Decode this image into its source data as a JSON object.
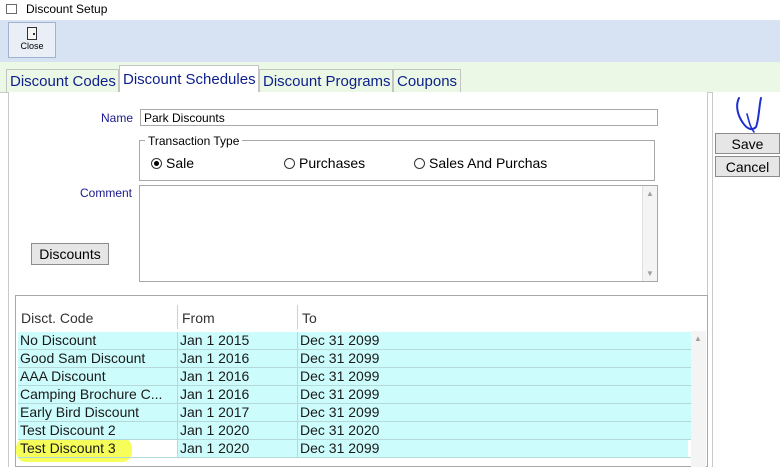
{
  "window": {
    "title": "Discount Setup"
  },
  "toolbar": {
    "close_label": "Close"
  },
  "tabs": [
    {
      "label": "Discount Codes",
      "active": false
    },
    {
      "label": "Discount Schedules",
      "active": true
    },
    {
      "label": "Discount Programs",
      "active": false
    },
    {
      "label": "Coupons",
      "active": false
    }
  ],
  "form": {
    "name_label": "Name",
    "name_value": "Park Discounts",
    "transaction_type_label": "Transaction Type",
    "radio_options": [
      {
        "label": "Sale",
        "selected": true
      },
      {
        "label": "Purchases",
        "selected": false
      },
      {
        "label": "Sales And Purchas",
        "selected": false
      }
    ],
    "comment_label": "Comment",
    "comment_value": "",
    "discounts_button": "Discounts"
  },
  "actions": {
    "save_label": "Save",
    "cancel_label": "Cancel"
  },
  "grid": {
    "columns": [
      "Disct. Code",
      "From",
      "To"
    ],
    "rows": [
      [
        "No Discount",
        "Jan 1 2015",
        "Dec 31 2099"
      ],
      [
        "Good Sam Discount",
        "Jan 1 2016",
        "Dec 31 2099"
      ],
      [
        "AAA Discount",
        "Jan 1 2016",
        "Dec 31 2099"
      ],
      [
        "Camping Brochure C...",
        "Jan 1 2016",
        "Dec 31 2099"
      ],
      [
        "Early Bird Discount",
        "Jan 1 2017",
        "Dec 31 2099"
      ],
      [
        "Test Discount 2",
        "Jan 1 2020",
        "Dec 31 2020"
      ],
      [
        "Test Discount 3",
        "Jan 1 2020",
        "Dec 31 2099"
      ]
    ],
    "highlighted_row": 6
  },
  "colors": {
    "toolbar_bg": "#d7e2f2",
    "tab_strip_bg": "#ecf8e6",
    "tab_text": "#0d1f8a",
    "label_text": "#1a1a8c",
    "row_bg": "#cdfcfc",
    "highlight": "#f4ff3c",
    "annotation": "#1f2fd0"
  },
  "icons": {
    "close": "door-exit-icon",
    "window": "window-icon"
  }
}
